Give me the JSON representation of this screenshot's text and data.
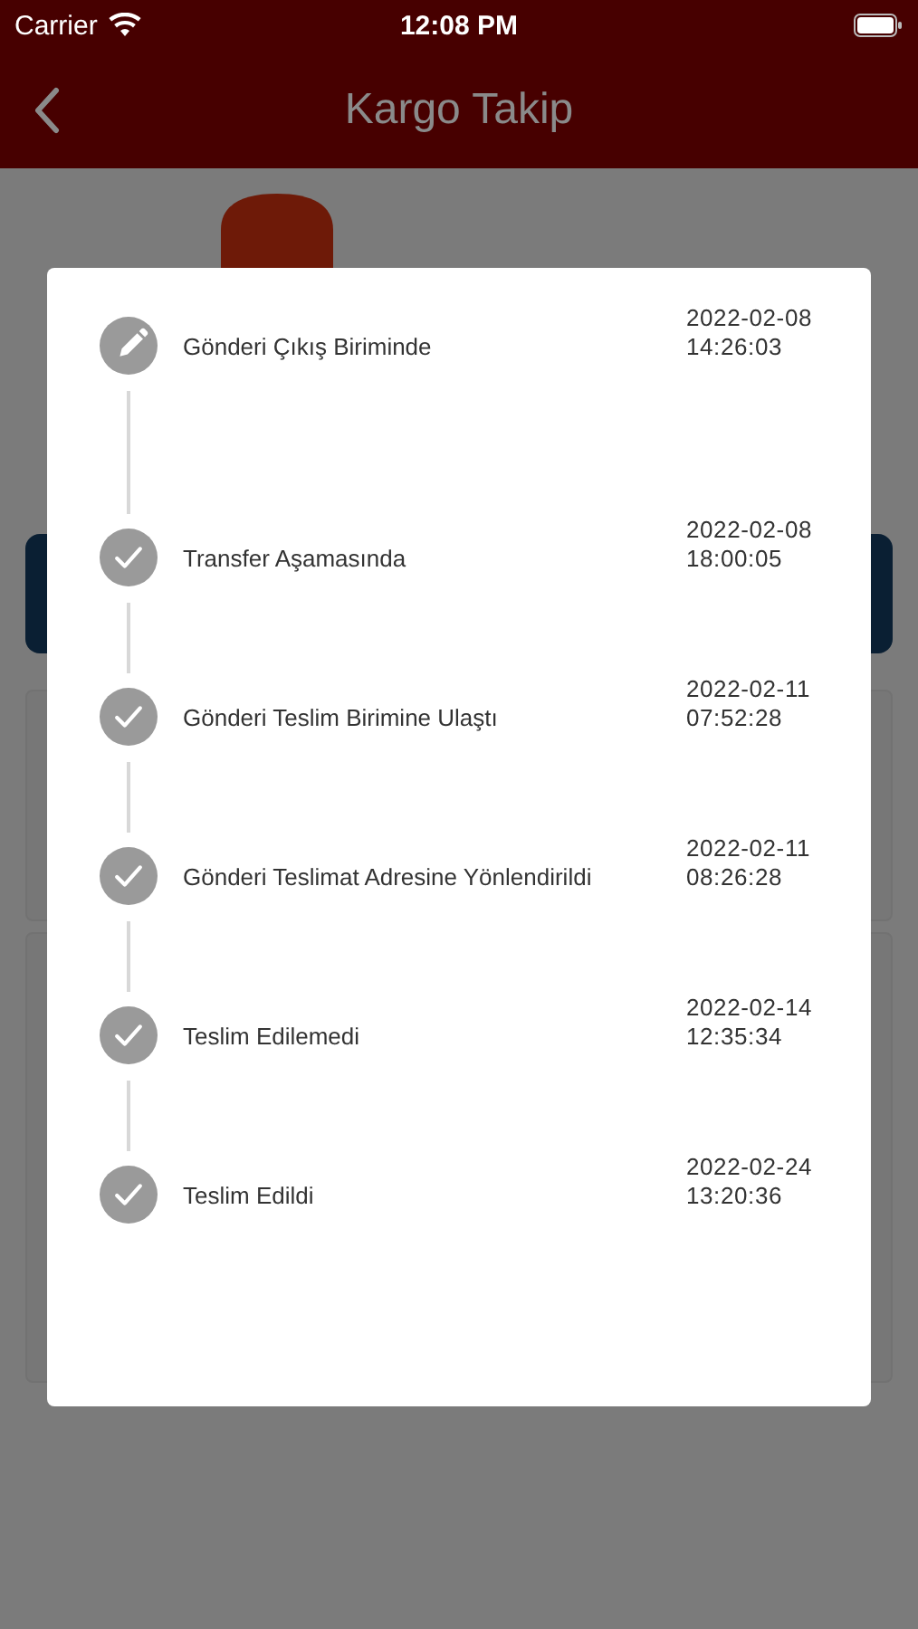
{
  "status_bar": {
    "carrier": "Carrier",
    "time": "12:08 PM"
  },
  "nav": {
    "title": "Kargo Takip"
  },
  "steps": [
    {
      "kind": "edit",
      "label": "Gönderi Çıkış Biriminde",
      "date": "2022-02-08 14:26:03"
    },
    {
      "kind": "done",
      "label": "Transfer Aşamasında",
      "date": "2022-02-08 18:00:05"
    },
    {
      "kind": "done",
      "label": "Gönderi Teslim Birimine Ulaştı",
      "date": "2022-02-11 07:52:28"
    },
    {
      "kind": "done",
      "label": "Gönderi Teslimat Adresine Yönlendirildi",
      "date": "2022-02-11 08:26:28"
    },
    {
      "kind": "done",
      "label": "Teslim Edilemedi",
      "date": "2022-02-14 12:35:34"
    },
    {
      "kind": "done",
      "label": "Teslim Edildi",
      "date": "2022-02-24 13:20:36"
    }
  ]
}
